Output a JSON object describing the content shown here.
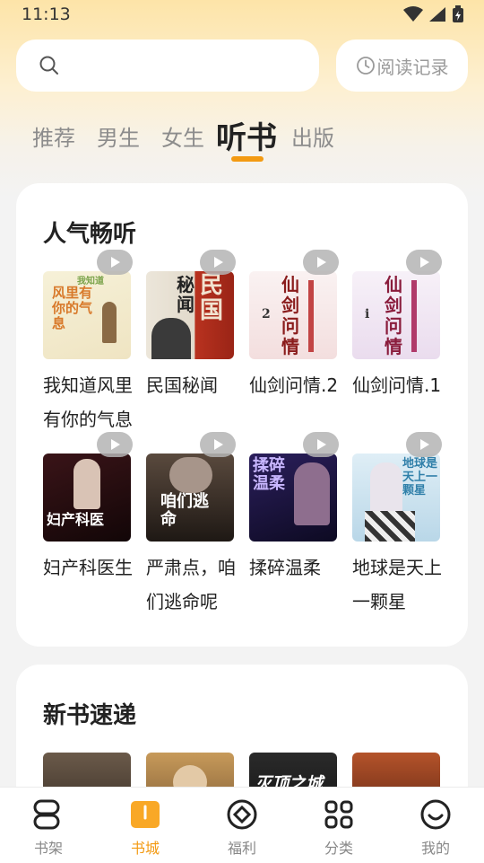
{
  "status_bar": {
    "time": "11:13"
  },
  "search": {
    "placeholder": ""
  },
  "history_button": {
    "label": "阅读记录"
  },
  "tabs": [
    {
      "label": "推荐"
    },
    {
      "label": "男生"
    },
    {
      "label": "女生"
    },
    {
      "label": "听书",
      "active": true
    },
    {
      "label": "出版"
    }
  ],
  "section_popular": {
    "title": "人气畅听",
    "books": [
      {
        "title": "我知道风里有你的气息"
      },
      {
        "title": "民国秘闻"
      },
      {
        "title": "仙剑问情.2"
      },
      {
        "title": "仙剑问情.1"
      },
      {
        "title": "妇产科医生"
      },
      {
        "title": "严肃点，咱们逃命呢"
      },
      {
        "title": "揉碎温柔"
      },
      {
        "title": "地球是天上一颗星"
      }
    ]
  },
  "section_new": {
    "title": "新书速递"
  },
  "covers": {
    "c1": {
      "top": "我知道",
      "main": "风里有你的气息"
    },
    "c2": {
      "main": "秘闻",
      "side": "民国"
    },
    "c3": {
      "main": "仙剑问情",
      "num": "2"
    },
    "c4": {
      "main": "仙剑问情",
      "num": "i"
    },
    "c5": {
      "main": "妇产科医"
    },
    "c6": {
      "main": "咱们逃命"
    },
    "c7": {
      "main": "揉碎温柔"
    },
    "c8": {
      "main": "地球是天上一颗星"
    },
    "n3": {
      "main": "灭顶之城"
    }
  },
  "bottom_nav": [
    {
      "label": "书架",
      "icon": "bookshelf-icon"
    },
    {
      "label": "书城",
      "icon": "bookstore-icon",
      "active": true
    },
    {
      "label": "福利",
      "icon": "welfare-icon"
    },
    {
      "label": "分类",
      "icon": "category-icon"
    },
    {
      "label": "我的",
      "icon": "profile-icon"
    }
  ],
  "colors": {
    "accent": "#f39a12",
    "text": "#222222",
    "muted": "#8c8c8c"
  }
}
